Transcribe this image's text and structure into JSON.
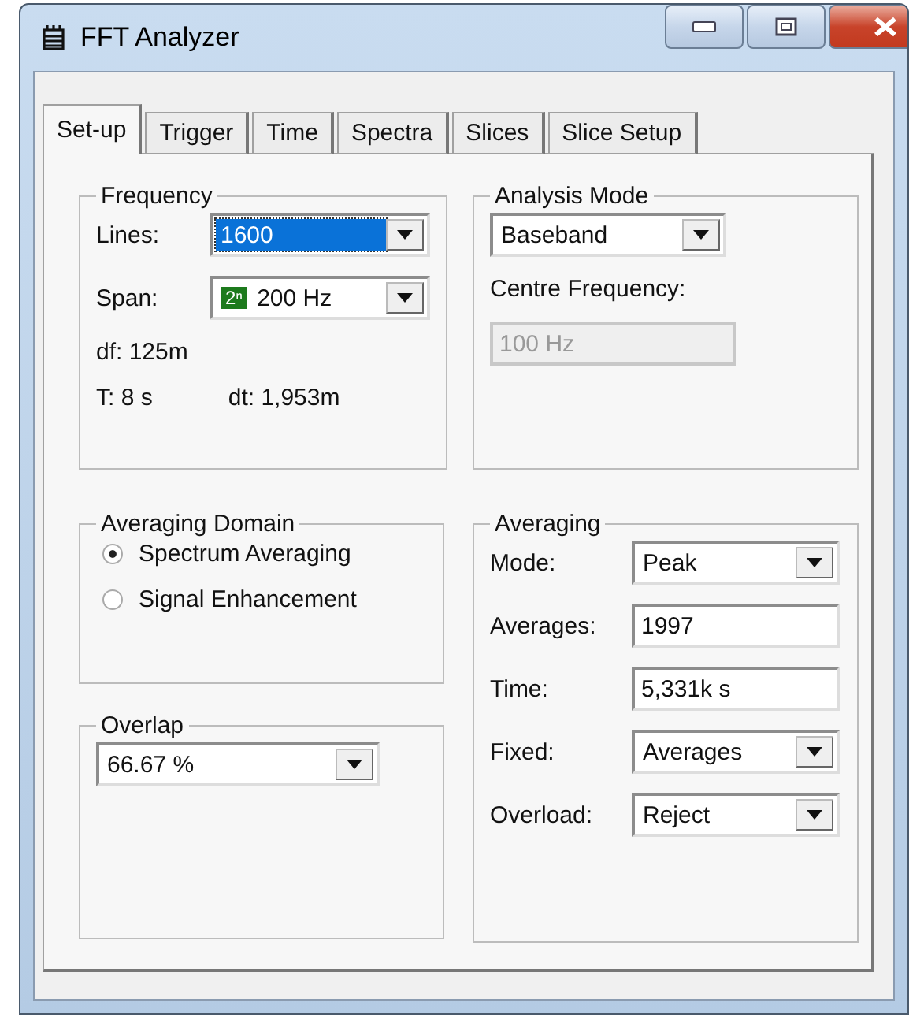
{
  "window": {
    "title": "FFT Analyzer"
  },
  "tabs": [
    {
      "label": "Set-up",
      "selected": true
    },
    {
      "label": "Trigger",
      "selected": false
    },
    {
      "label": "Time",
      "selected": false
    },
    {
      "label": "Spectra",
      "selected": false
    },
    {
      "label": "Slices",
      "selected": false
    },
    {
      "label": "Slice Setup",
      "selected": false
    }
  ],
  "frequency": {
    "title": "Frequency",
    "lines": {
      "label": "Lines:",
      "value": "1600",
      "selected": true
    },
    "span": {
      "label": "Span:",
      "badge": "2ⁿ",
      "value": "200 Hz",
      "selected": false
    },
    "df": "df: 125m",
    "t": "T: 8 s",
    "dt": "dt: 1,953m"
  },
  "analysis_mode": {
    "title": "Analysis Mode",
    "value": "Baseband",
    "centre_label": "Centre Frequency:",
    "centre_value": "100 Hz",
    "centre_disabled": true
  },
  "averaging_domain": {
    "title": "Averaging Domain",
    "options": [
      {
        "label": "Spectrum Averaging",
        "selected": true
      },
      {
        "label": "Signal Enhancement",
        "selected": false
      }
    ]
  },
  "overlap": {
    "title": "Overlap",
    "value": "66.67 %"
  },
  "averaging": {
    "title": "Averaging",
    "fields": [
      {
        "kind": "dropdown",
        "label": "Mode:",
        "value": "Peak"
      },
      {
        "kind": "text",
        "label": "Averages:",
        "value": "1997"
      },
      {
        "kind": "text",
        "label": "Time:",
        "value": "5,331k s"
      },
      {
        "kind": "dropdown",
        "label": "Fixed:",
        "value": "Averages"
      },
      {
        "kind": "dropdown",
        "label": "Overload:",
        "value": "Reject"
      }
    ]
  }
}
